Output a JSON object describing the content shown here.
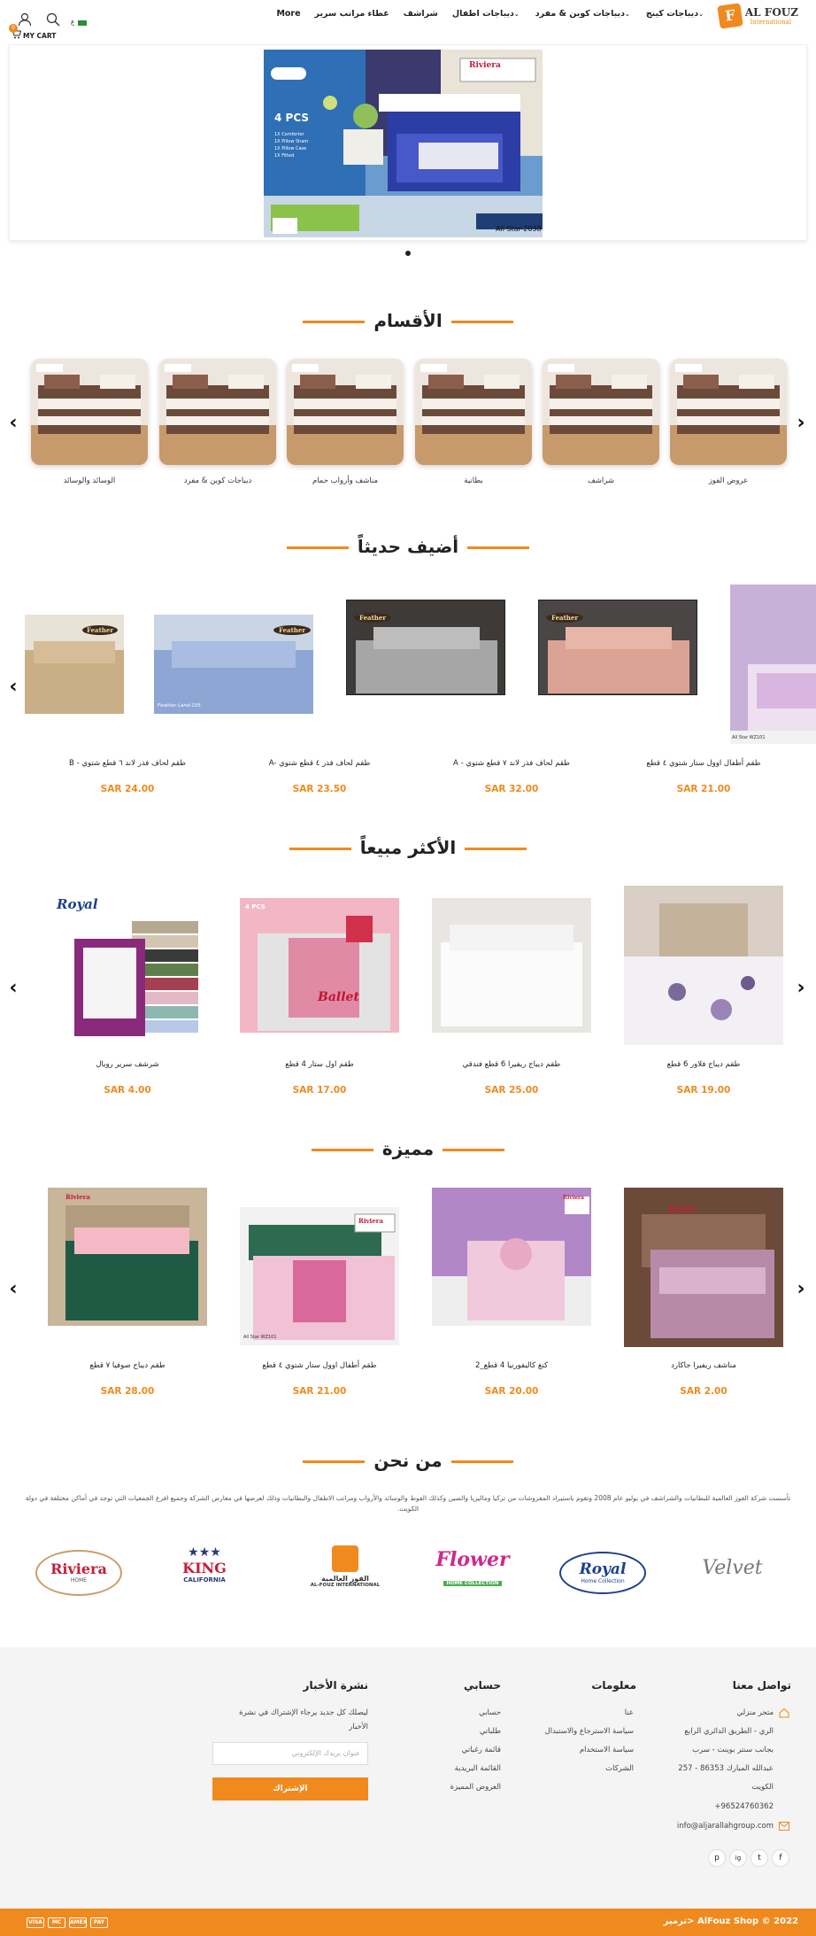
{
  "header": {
    "logo_text": "AL FOUZ",
    "logo_sub": "International",
    "logo_letter": "F",
    "nav": [
      {
        "label": "ديباجات كينج",
        "dropdown": true
      },
      {
        "label": "ديباجات كوين & مفرد",
        "dropdown": true
      },
      {
        "label": "ديباجات اطفال",
        "dropdown": true
      },
      {
        "label": "شراشف",
        "dropdown": false
      },
      {
        "label": "غطاء مراتب سرير",
        "dropdown": false
      },
      {
        "label": "More",
        "dropdown": false
      }
    ],
    "cart_label": "MY CART",
    "cart_count": "0",
    "flag_label": "ع"
  },
  "hero": {
    "brand": "Riviera",
    "pcs": "4 PCS",
    "code": "All Star-2038",
    "spec_lines": [
      "1X Comforter",
      "1X Pillow Sham",
      "1X Pillow Case",
      "1X Fitted"
    ]
  },
  "sections": {
    "categories_title": "الأقسام",
    "new_title": "أضيف حديثاً",
    "best_title": "الأكثر مبيعاً",
    "featured_title": "مميزة",
    "about_title": "من نحن"
  },
  "categories": [
    "عروض الفوز",
    "شراشف",
    "بطانية",
    "مناشف وأرواب حمام",
    "ديباجات كوين & مفرد",
    "الوسائد والوسائد"
  ],
  "new_products": [
    {
      "name": "طقم أطفال اوول ستار شتوي ٤ قطع",
      "price": "SAR 21.00"
    },
    {
      "name": "A - طقم لحاف فذر لاند ٧ قطع شتوي",
      "price": "SAR 32.00"
    },
    {
      "name": "A- طقم لحاف فذر ٤ قطع شتوي",
      "price": "SAR 23.50"
    },
    {
      "name": "B - طقم لحاف فذر لاند ٦ قطع شتوي",
      "price": "SAR 24.00"
    }
  ],
  "best_products": [
    {
      "name": "طقم ديباج فلاور 6 قطع",
      "price": "SAR 19.00"
    },
    {
      "name": "طقم ديباج ريفيرا 6 قطع فندقي",
      "price": "SAR 25.00"
    },
    {
      "name": "طقم اول ستار 4 قطع",
      "price": "SAR 17.00"
    },
    {
      "name": "شرشف سرير رويال",
      "price": "SAR 4.00"
    }
  ],
  "featured_products": [
    {
      "name": "مناشف ريفيرا جاكارد",
      "price": "SAR 2.00"
    },
    {
      "name": "كنغ كاليفورنيا 4 قطع_2",
      "price": "SAR 20.00"
    },
    {
      "name": "طقم أطفال اوول ستار شتوي ٤ قطع",
      "price": "SAR 21.00"
    },
    {
      "name": "طقم ديباج صوفيا ٧ قطع",
      "price": "SAR 28.00"
    }
  ],
  "product_labels": {
    "feather": "Feather",
    "royal": "Royal",
    "riviera": "Riviera",
    "king": "KING",
    "allstar_code": "All Star WZ101",
    "allstar_code2": "All Star WZ101",
    "feather_land": "Feather Land-105",
    "ballet": "Ballet",
    "pcs": "4 PCS"
  },
  "about": {
    "text": "تأسست شركة الفوز العالمية للبطانيات والشراشف في يوليو عام 2008 وتقوم باستيراد المفروشات من تركيا وماليزيا والصين وكذلك الفوط والوسائد والأرواب ومراتب الاطفال والبطانيات وذلك لعرضها في معارض الشركة وجميع افرع الجمعيات التي توجد في أماكن مختلفة في دولة الكويت."
  },
  "brands": [
    {
      "name": "Riviera",
      "sub": "HOME"
    },
    {
      "name": "KING",
      "sub": "CALIFORNIA"
    },
    {
      "name": "الفوز العالمية",
      "sub": "AL-FOUZ INTERNATIONAL"
    },
    {
      "name": "Flower",
      "sub": "HOME COLLECTION"
    },
    {
      "name": "Royal",
      "sub": "Home Collection"
    },
    {
      "name": "Velvet",
      "sub": ""
    }
  ],
  "footer": {
    "contact_title": "تواصل معنا",
    "contact_lines": [
      "متجر منزلي",
      "الري - الطريق الدائري الرابع",
      "بجانب سنتر بوينت - سرب",
      "257 - عبدالله المبارك 86353",
      "الكويت",
      "+96524760362",
      "info@aljarallahgroup.com"
    ],
    "info_title": "معلومات",
    "info_links": [
      "عنا",
      "سياسة الاسترجاع والاستبدال",
      "سياسة الاستخدام",
      "الشركات"
    ],
    "account_title": "حسابي",
    "account_links": [
      "حسابي",
      "طلباتي",
      "قائمة رغباتي",
      "القائمة البريدية",
      "العروض المميزة"
    ],
    "newsletter_title": "نشرة الأخبار",
    "newsletter_text_1": "ليصلك كل جديد يرجاء الإشتراك في نشرة",
    "newsletter_text_2": "الأخبار",
    "email_placeholder": "عنوان بريدك الإلكتروني",
    "subscribe_label": "الإشتراك",
    "social": [
      "f",
      "t",
      "ig",
      "p"
    ],
    "copyright": "ترميز> AlFouz Shop © 2022",
    "payments": [
      "VISA",
      "MC",
      "AMEX",
      "PAY"
    ]
  },
  "colors": {
    "accent": "#f08a1e",
    "footer_bg": "#f4f4f4"
  }
}
